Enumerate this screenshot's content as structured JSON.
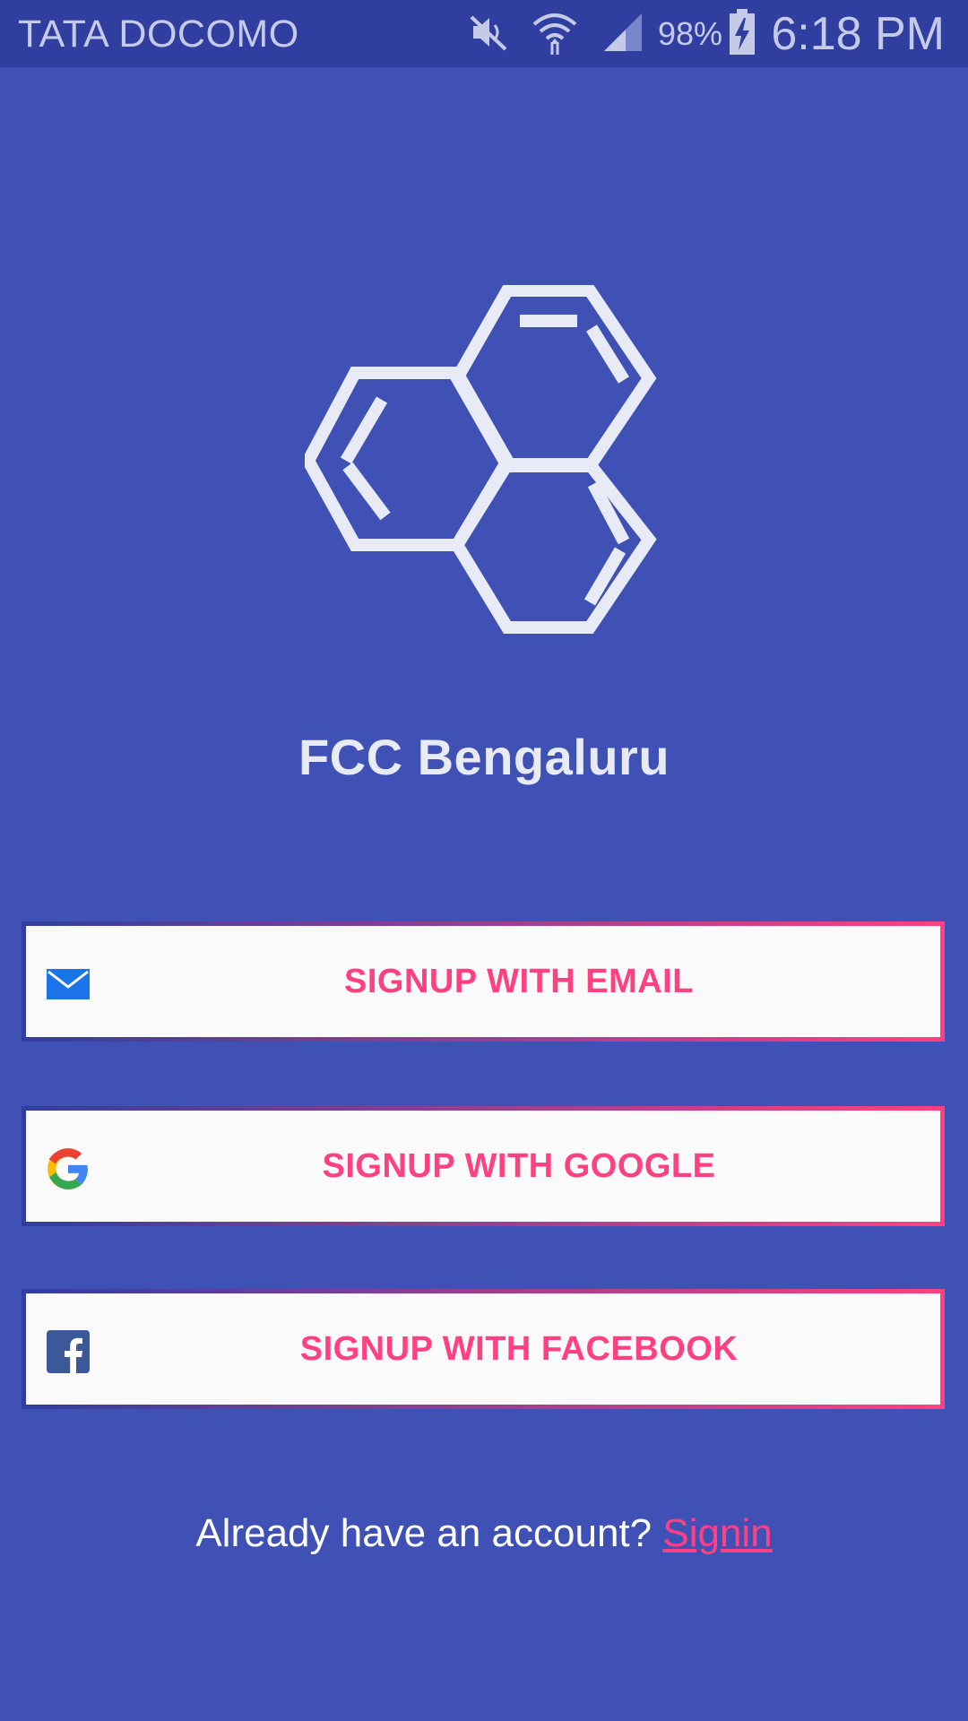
{
  "status_bar": {
    "carrier": "TATA DOCOMO",
    "battery_percent": "98%",
    "time": "6:18 PM",
    "icons": [
      "mute-icon",
      "wifi-icon",
      "signal-icon",
      "battery-charging-icon"
    ]
  },
  "app": {
    "title": "FCC Bengaluru",
    "logo_icon": "hexagon-molecule-logo"
  },
  "buttons": {
    "email": {
      "label": "SIGNUP WITH EMAIL",
      "icon": "email-icon"
    },
    "google": {
      "label": "SIGNUP WITH GOOGLE",
      "icon": "google-icon"
    },
    "facebook": {
      "label": "SIGNUP WITH FACEBOOK",
      "icon": "facebook-icon"
    }
  },
  "footer": {
    "prompt": "Already have an account? ",
    "signin_label": "Signin"
  },
  "colors": {
    "background": "#3F51B5",
    "status_bar": "#303F9F",
    "accent": "#FF4081",
    "button_bg": "#FAFAFA",
    "logo": "#E8EAF6"
  }
}
